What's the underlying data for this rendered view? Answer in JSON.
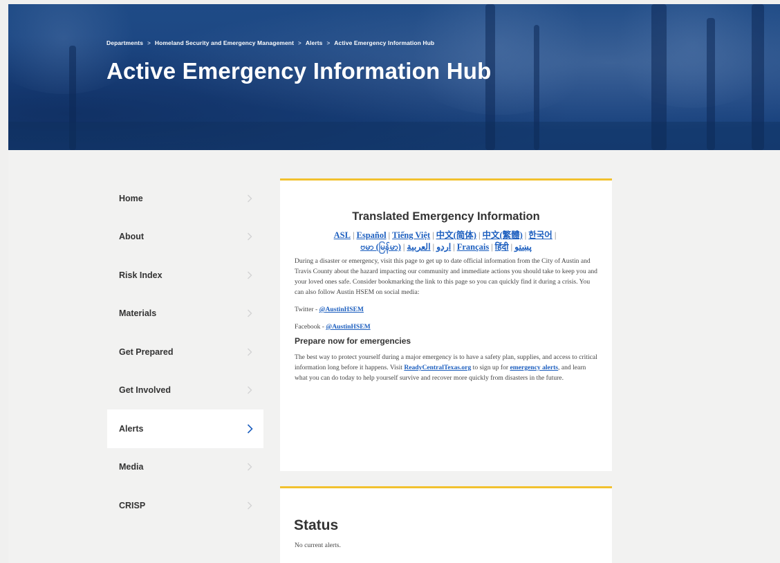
{
  "breadcrumb": {
    "items": [
      "Departments",
      "Homeland Security and Emergency Management",
      "Alerts",
      "Active Emergency Information Hub"
    ],
    "separator": ">"
  },
  "page_title": "Active Emergency Information Hub",
  "sidebar": {
    "items": [
      {
        "label": "Home"
      },
      {
        "label": "About"
      },
      {
        "label": "Risk Index"
      },
      {
        "label": "Materials"
      },
      {
        "label": "Get Prepared"
      },
      {
        "label": "Get Involved"
      },
      {
        "label": "Alerts",
        "active": true
      },
      {
        "label": "Media"
      },
      {
        "label": "CRISP"
      }
    ]
  },
  "translated": {
    "title": "Translated Emergency Information",
    "languages_row1": [
      "ASL",
      "Español",
      "Tiếng Việt",
      "中文(简体)",
      "中文(繁體)",
      "한국어"
    ],
    "languages_row2": [
      "ဗမာ (မြန်မာ)",
      "اردو",
      "العربية",
      "Français",
      "हिंदी",
      "پښتو"
    ],
    "intro": "During a disaster or emergency, visit this page to get up to date official information from the City of Austin and Travis County about the hazard impacting our community and immediate actions you should take to keep you and your loved ones safe.  Consider bookmarking the link to this page so you can quickly find it during a crisis. You can also follow Austin HSEM on social media:",
    "twitter_label": "Twitter - ",
    "twitter_handle": "@AustinHSEM",
    "facebook_label": "Facebook - ",
    "facebook_handle": "@AustinHSEM",
    "prepare_heading": "Prepare now for emergencies",
    "prepare_text_1": "The best way to protect yourself during a major emergency is to have a safety plan, supplies, and access to critical information long before it happens. Visit ",
    "prepare_link_1": "ReadyCentralTexas.org",
    "prepare_text_2": " to sign up for ",
    "prepare_link_2": "emergency alerts",
    "prepare_text_3": ", and learn what you can do today to help yourself survive and recover more quickly from disasters in the future."
  },
  "status": {
    "title": "Status",
    "text": "No current alerts."
  },
  "colors": {
    "hero": "#1f4b86",
    "accent_border": "#f2c12e",
    "link": "#1d5fbf"
  },
  "icons": {
    "sidebar_chevron": "chevron-right-icon"
  }
}
